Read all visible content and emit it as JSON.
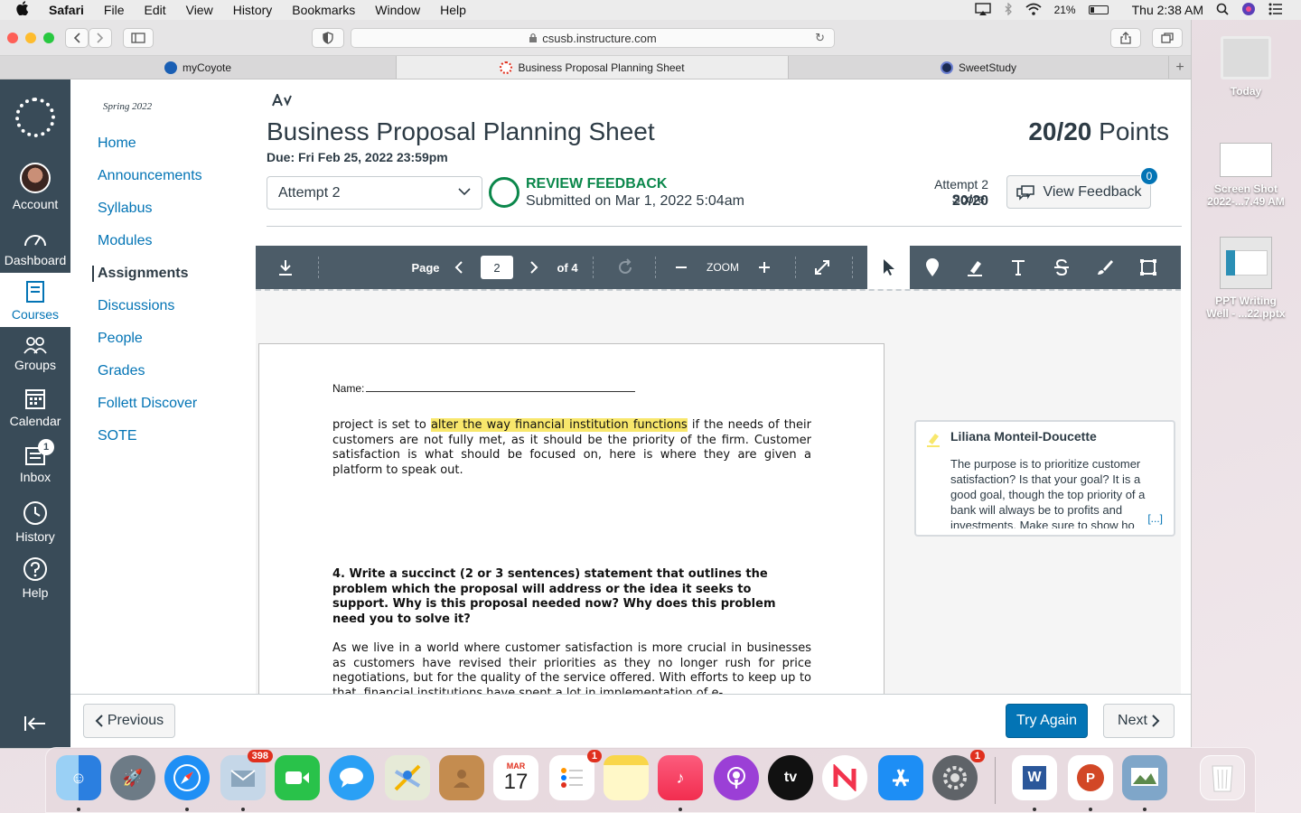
{
  "menubar": {
    "app": "Safari",
    "items": [
      "File",
      "Edit",
      "View",
      "History",
      "Bookmarks",
      "Window",
      "Help"
    ],
    "battery": "21%",
    "clock": "Thu 2:38 AM"
  },
  "browser": {
    "url": "csusb.instructure.com",
    "tabs": [
      {
        "label": "myCoyote",
        "icon_color": "#1a5fb4"
      },
      {
        "label": "Business Proposal Planning Sheet",
        "icon_color": "#e0301e"
      },
      {
        "label": "SweetStudy",
        "icon_color": "#1b2a52"
      }
    ]
  },
  "global_nav": {
    "items": [
      "Account",
      "Dashboard",
      "Courses",
      "Groups",
      "Calendar",
      "Inbox",
      "History",
      "Help"
    ],
    "inbox_badge": "1"
  },
  "course_nav": {
    "term": "Spring 2022",
    "links": [
      "Home",
      "Announcements",
      "Syllabus",
      "Modules",
      "Assignments",
      "Discussions",
      "People",
      "Grades",
      "Follett Discover",
      "SOTE"
    ],
    "active": "Assignments"
  },
  "assignment": {
    "title": "Business Proposal Planning Sheet",
    "due": "Due: Fri Feb 25, 2022 23:59pm",
    "points_value": "20/20",
    "points_label": "Points",
    "attempt_select": "Attempt 2",
    "review_title": "REVIEW FEEDBACK",
    "review_sub": "Submitted on Mar 1, 2022 5:04am",
    "score_label": "Attempt 2 Score:",
    "score_value": "20/20",
    "view_feedback": "View Feedback",
    "feedback_count": "0"
  },
  "docviewer": {
    "page_label": "Page",
    "page_current": "2",
    "page_total": "of 4",
    "zoom_label": "ZOOM"
  },
  "document": {
    "name_label": "Name:",
    "para1_before": "project is set to ",
    "para1_highlight": "alter the way financial institution functions",
    "para1_after": " if the needs of their customers are not fully met, as it should be the priority of the firm. Customer satisfaction is what should be focused on, here is where they are given a platform to speak out.",
    "question": "4. Write a succinct (2 or 3 sentences) statement that outlines the problem which the proposal will address or the idea it seeks to support.  Why is this proposal needed now?  Why does this problem need you to solve it?",
    "answer": "As we live in a world where customer satisfaction is more crucial in businesses as customers have revised their priorities as they no longer rush for price negotiations, but for the quality of the service offered. With efforts to keep up to that, financial institutions have spent a lot in implementation of e-"
  },
  "comment": {
    "author": "Liliana Monteil-Doucette",
    "body": "The purpose is to prioritize customer satisfaction? Is that your goal? It is a good goal, though the top priority of a bank will always be to profits and investments. Make sure to show ho",
    "more": "[...]"
  },
  "footer": {
    "previous": "Previous",
    "try_again": "Try Again",
    "next": "Next"
  },
  "desktop": {
    "items": [
      "Today",
      "Screen Shot 2022-...7.49 AM",
      "PPT Writing Well - ...22.pptx"
    ]
  },
  "dock": {
    "mail_badge": "398",
    "calendar_month": "MAR",
    "calendar_day": "17",
    "reminders_badge": "1",
    "settings_badge": "1"
  }
}
